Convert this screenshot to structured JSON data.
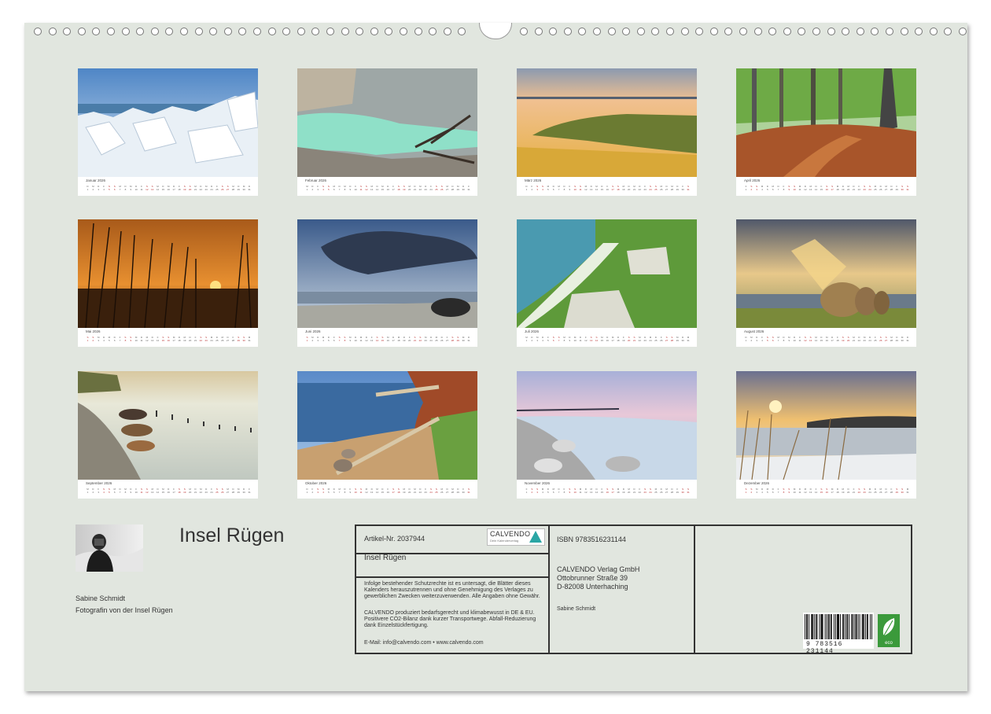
{
  "calendar": {
    "title": "Insel Rügen",
    "months": [
      {
        "label": "Januar 2026",
        "scene": "ice-shore"
      },
      {
        "label": "Februar 2026",
        "scene": "misty-cliff"
      },
      {
        "label": "März 2026",
        "scene": "reed-lake-dawn"
      },
      {
        "label": "April 2026",
        "scene": "beech-forest"
      },
      {
        "label": "Mai 2026",
        "scene": "reed-sunset"
      },
      {
        "label": "Juni 2026",
        "scene": "stormy-beach"
      },
      {
        "label": "Juli 2026",
        "scene": "chalk-coast-aerial"
      },
      {
        "label": "August 2026",
        "scene": "hay-bales"
      },
      {
        "label": "September 2026",
        "scene": "rocky-shore-groynes"
      },
      {
        "label": "Oktober 2026",
        "scene": "driftwood-beach"
      },
      {
        "label": "November 2026",
        "scene": "frozen-shore"
      },
      {
        "label": "Dezember 2026",
        "scene": "winter-sunset-reed"
      }
    ],
    "weekday_letters": [
      "M",
      "D",
      "M",
      "D",
      "F",
      "S",
      "S"
    ]
  },
  "author": {
    "name": "Sabine Schmidt",
    "description": "Fotografin von der Insel Rügen"
  },
  "info": {
    "article_no": "Artikel-Nr. 2037944",
    "product_title": "Insel Rügen",
    "legal_text": "Infolge bestehender Schutzrechte ist es untersagt, die Blätter dieses Kalenders herauszutrennen und ohne Genehmigung des Verlages zu gewerblichen Zwecken weiterzuverwenden. Alle Angaben ohne Gewähr.",
    "eco_text": "CALVENDO produziert bedarfsgerecht und klimabewusst in DE & EU. Positivere CO2-Bilanz dank kurzer Transportwege. Abfall-Reduzierung dank Einzelstückfertigung.",
    "contact": "E-Mail: info@calvendo.com • www.calvendo.com",
    "isbn": "ISBN 9783516231144",
    "publisher_name": "CALVENDO Verlag GmbH",
    "publisher_street": "Ottobrunner Straße 39",
    "publisher_city": "D-82008 Unterhaching",
    "photographer": "Sabine Schmidt",
    "logo_text": "CALVENDO",
    "logo_sub": "Dein Kalenderverlag",
    "barcode_number": "9 783516 231144",
    "eco_label": "eco"
  },
  "colors": {
    "sheet": "#e1e6df",
    "frame": "#333333",
    "eco_green": "#3b9a3b",
    "calvendo_teal": "#2aa6a5"
  }
}
